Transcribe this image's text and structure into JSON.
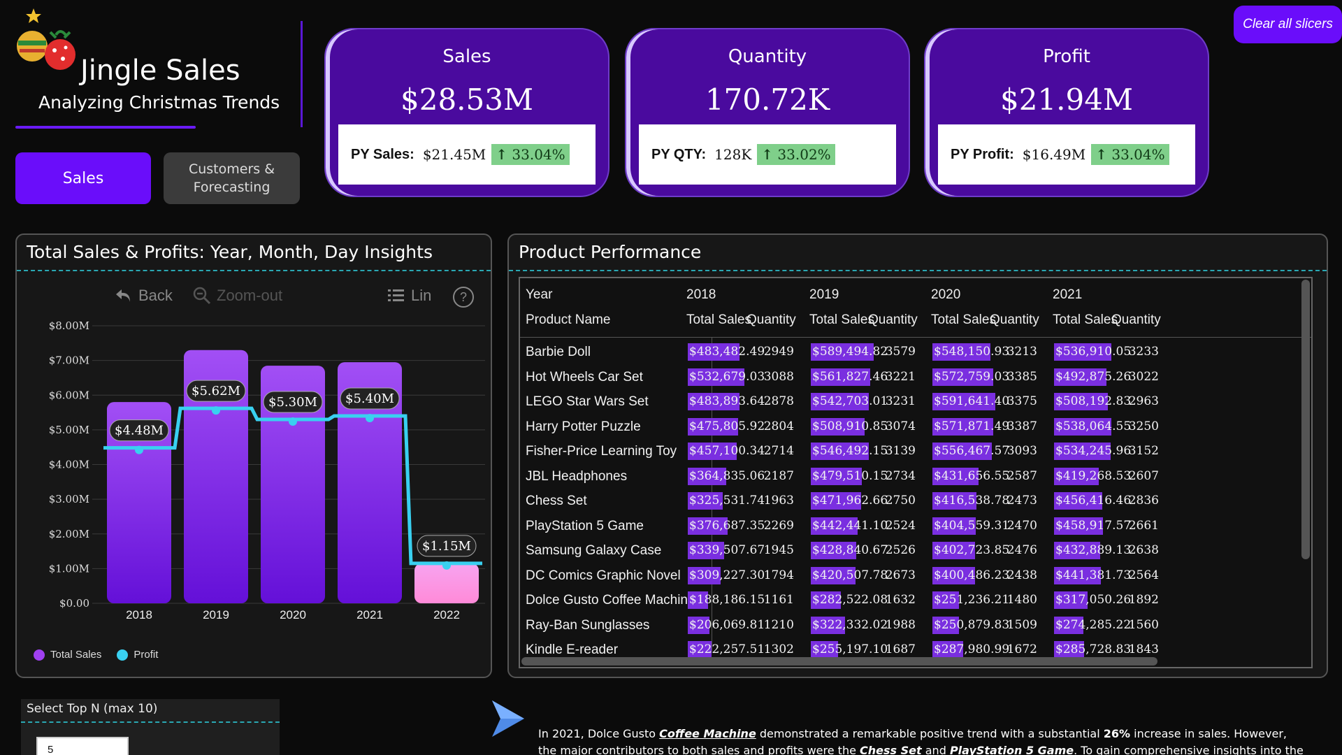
{
  "brand": {
    "title": "Jingle Sales",
    "subtitle": "Analyzing Christmas Trends"
  },
  "nav": {
    "sales": "Sales",
    "customers": "Customers & Forecasting"
  },
  "clear_label": "Clear all slicers",
  "kpis": [
    {
      "title": "Sales",
      "value": "$28.53M",
      "py_label": "PY Sales:",
      "py_value": "$21.45M",
      "change": "33.04%"
    },
    {
      "title": "Quantity",
      "value": "170.72K",
      "py_label": "PY QTY:",
      "py_value": "128K",
      "change": "33.02%"
    },
    {
      "title": "Profit",
      "value": "$21.94M",
      "py_label": "PY Profit:",
      "py_value": "$16.49M",
      "change": "33.04%"
    }
  ],
  "chart_panel": {
    "title": "Total Sales & Profits: Year, Month, Day Insights",
    "toolbar": {
      "back": "Back",
      "zoom_out": "Zoom-out",
      "lin": "Lin",
      "help": "?"
    }
  },
  "chart_data": {
    "type": "bar",
    "categories": [
      "2018",
      "2019",
      "2020",
      "2021",
      "2022"
    ],
    "series": [
      {
        "name": "Total Sales",
        "values": [
          5.8,
          7.3,
          6.85,
          6.95,
          1.15
        ],
        "color": "#8a2be2"
      },
      {
        "name": "Profit",
        "values": [
          4.48,
          5.62,
          5.3,
          5.4,
          1.15
        ],
        "color": "#39d0f0",
        "labels": [
          "$4.48M",
          "$5.62M",
          "$5.30M",
          "$5.40M",
          "$1.15M"
        ]
      }
    ],
    "y_ticks": [
      "$0.00",
      "$1.00M",
      "$2.00M",
      "$3.00M",
      "$4.00M",
      "$5.00M",
      "$6.00M",
      "$7.00M",
      "$8.00M"
    ],
    "ylim": [
      0,
      8
    ],
    "grid": true,
    "legend": "bottom-left"
  },
  "table": {
    "title": "Product Performance",
    "year_label": "Year",
    "product_label": "Product Name",
    "years": [
      "2018",
      "2019",
      "2020",
      "2021"
    ],
    "sub_headers": [
      "Total Sales",
      "Quantity"
    ],
    "rows": [
      {
        "name": "Barbie Doll",
        "cells": [
          [
            "$483,482.49",
            "2949"
          ],
          [
            "$589,494.82",
            "3579"
          ],
          [
            "$548,150.93",
            "3213"
          ],
          [
            "$536,910.05",
            "3233"
          ]
        ]
      },
      {
        "name": "Hot Wheels Car Set",
        "cells": [
          [
            "$532,679.03",
            "3088"
          ],
          [
            "$561,827.46",
            "3221"
          ],
          [
            "$572,759.03",
            "3385"
          ],
          [
            "$492,875.26",
            "3022"
          ]
        ]
      },
      {
        "name": "LEGO Star Wars Set",
        "cells": [
          [
            "$483,893.64",
            "2878"
          ],
          [
            "$542,703.01",
            "3231"
          ],
          [
            "$591,641.40",
            "3375"
          ],
          [
            "$508,192.83",
            "2963"
          ]
        ]
      },
      {
        "name": "Harry Potter Puzzle",
        "cells": [
          [
            "$475,805.92",
            "2804"
          ],
          [
            "$508,910.85",
            "3074"
          ],
          [
            "$571,871.49",
            "3387"
          ],
          [
            "$538,064.55",
            "3250"
          ]
        ]
      },
      {
        "name": "Fisher-Price Learning Toy",
        "cells": [
          [
            "$457,100.34",
            "2714"
          ],
          [
            "$546,492.15",
            "3139"
          ],
          [
            "$556,467.57",
            "3093"
          ],
          [
            "$534,245.96",
            "3152"
          ]
        ]
      },
      {
        "name": "JBL Headphones",
        "cells": [
          [
            "$364,835.06",
            "2187"
          ],
          [
            "$479,510.15",
            "2734"
          ],
          [
            "$431,656.55",
            "2587"
          ],
          [
            "$419,268.53",
            "2607"
          ]
        ]
      },
      {
        "name": "Chess Set",
        "cells": [
          [
            "$325,531.74",
            "1963"
          ],
          [
            "$471,962.66",
            "2750"
          ],
          [
            "$416,538.78",
            "2473"
          ],
          [
            "$456,416.46",
            "2836"
          ]
        ]
      },
      {
        "name": "PlayStation 5 Game",
        "cells": [
          [
            "$376,687.35",
            "2269"
          ],
          [
            "$442,441.10",
            "2524"
          ],
          [
            "$404,559.31",
            "2470"
          ],
          [
            "$458,917.57",
            "2661"
          ]
        ]
      },
      {
        "name": "Samsung Galaxy Case",
        "cells": [
          [
            "$339,507.67",
            "1945"
          ],
          [
            "$428,840.67",
            "2526"
          ],
          [
            "$402,723.85",
            "2476"
          ],
          [
            "$432,889.13",
            "2638"
          ]
        ]
      },
      {
        "name": "DC Comics Graphic Novel",
        "cells": [
          [
            "$309,227.30",
            "1794"
          ],
          [
            "$420,507.78",
            "2673"
          ],
          [
            "$400,486.23",
            "2438"
          ],
          [
            "$441,381.73",
            "2564"
          ]
        ]
      },
      {
        "name": "Dolce Gusto Coffee Machine",
        "cells": [
          [
            "$188,186.15",
            "1161"
          ],
          [
            "$282,522.08",
            "1632"
          ],
          [
            "$251,236.21",
            "1480"
          ],
          [
            "$317,050.26",
            "1892"
          ]
        ]
      },
      {
        "name": "Ray-Ban Sunglasses",
        "cells": [
          [
            "$206,069.81",
            "1210"
          ],
          [
            "$322,332.02",
            "1988"
          ],
          [
            "$250,879.83",
            "1509"
          ],
          [
            "$274,285.22",
            "1560"
          ]
        ]
      },
      {
        "name": "Kindle E-reader",
        "cells": [
          [
            "$222,257.51",
            "1302"
          ],
          [
            "$255,197.10",
            "1687"
          ],
          [
            "$287,980.99",
            "1672"
          ],
          [
            "$285,728.83",
            "1843"
          ]
        ]
      }
    ]
  },
  "topn": {
    "label": "Select Top N (max 10)",
    "value": "5"
  },
  "insight": {
    "p1": "In 2021, Dolce Gusto ",
    "l1": "Coffee Machine",
    "p2": " demonstrated a remarkable positive trend with a substantial ",
    "b1": "26%",
    "p3": " increase in sales. However, the major contributors to both sales and profits were the ",
    "l2": "Chess Set",
    "p4": " and ",
    "l3": "PlayStation 5 Game",
    "p5": ". To gain comprehensive insights into the performance of all"
  },
  "colors": {
    "accent": "#6a0dfa",
    "card": "#4a0a9e",
    "profit_line": "#39d0f0",
    "increase": "#7fcf8a"
  }
}
